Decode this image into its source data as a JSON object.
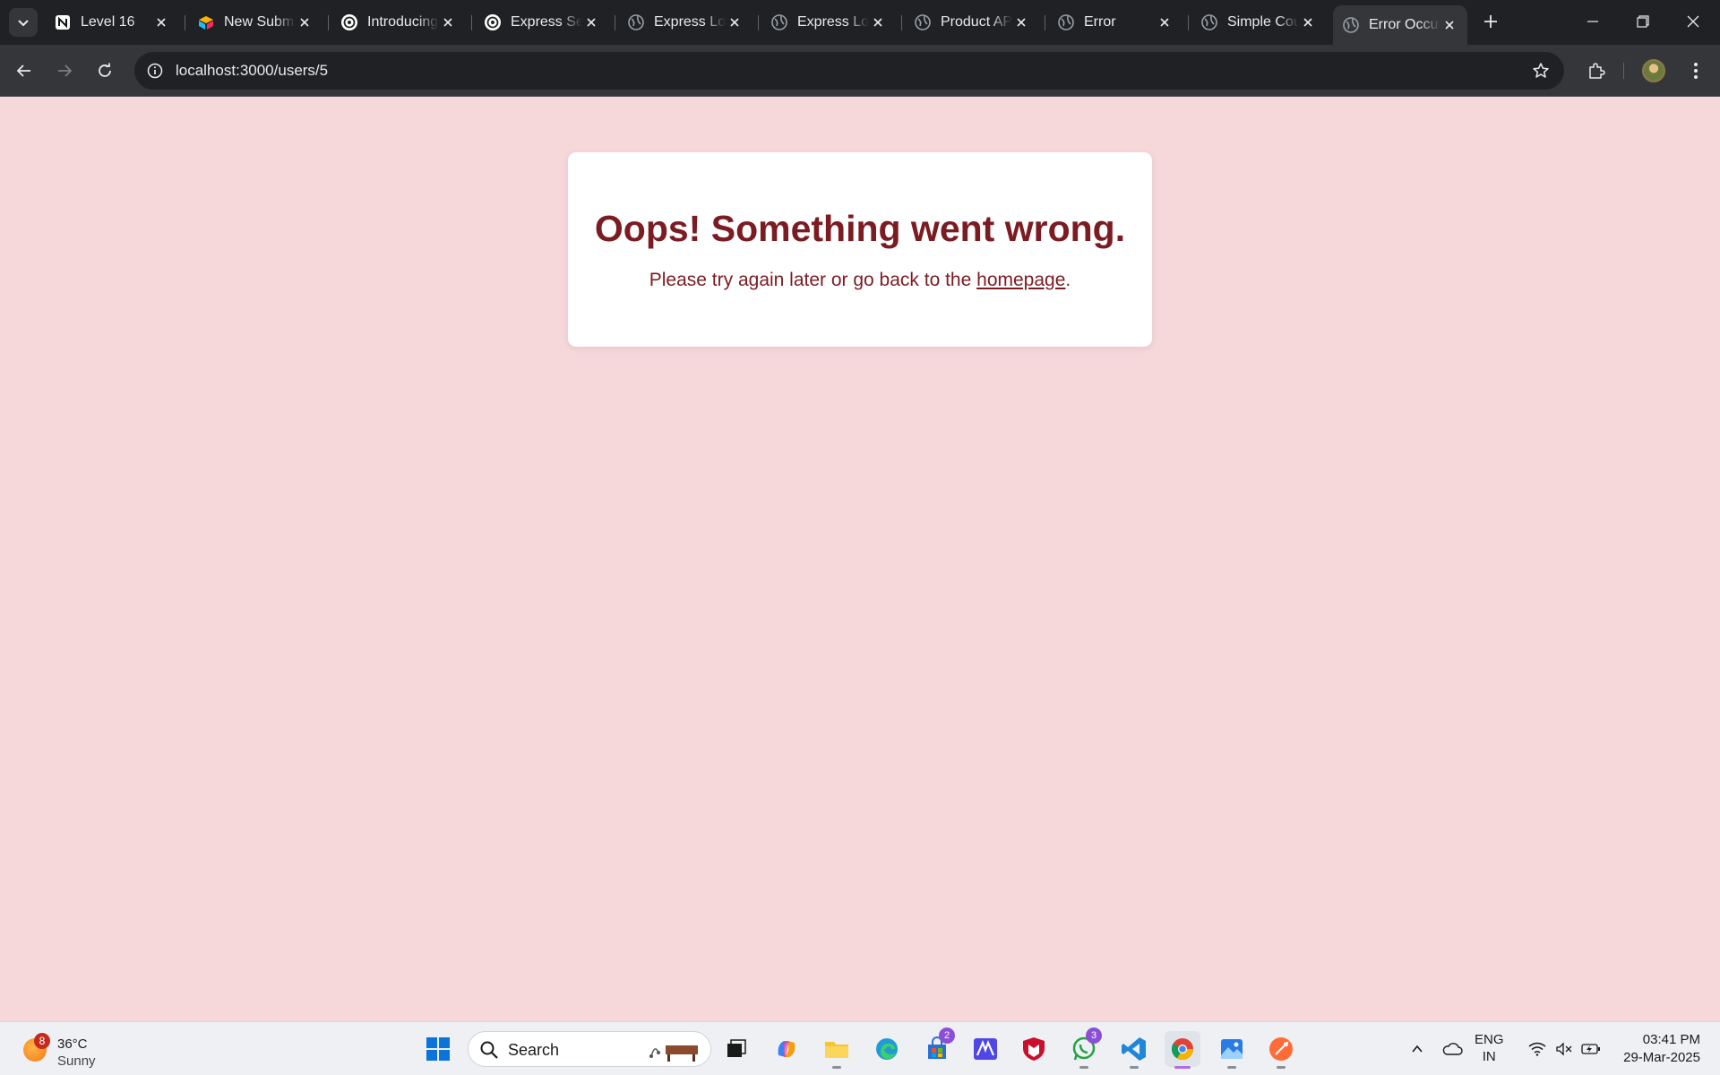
{
  "browser": {
    "tabs": [
      {
        "label": "Level 16",
        "icon": "notion-icon"
      },
      {
        "label": "New Submission",
        "icon": "cube-icon"
      },
      {
        "label": "Introducing",
        "icon": "openai-icon"
      },
      {
        "label": "Express Server",
        "icon": "openai-icon"
      },
      {
        "label": "Express Logging",
        "icon": "globe-icon"
      },
      {
        "label": "Express Logging",
        "icon": "globe-icon"
      },
      {
        "label": "Product API",
        "icon": "globe-icon"
      },
      {
        "label": "Error",
        "icon": "globe-icon"
      },
      {
        "label": "Simple Counter",
        "icon": "globe-icon"
      },
      {
        "label": "Error Occurred",
        "icon": "globe-icon",
        "active": true
      }
    ],
    "url": "localhost:3000/users/5"
  },
  "page": {
    "title": "Oops! Something went wrong.",
    "message_before": "Please try again later or go back to the ",
    "link_text": "homepage",
    "message_after": ".",
    "colors": {
      "background": "#f6d7da",
      "text": "#7b1b22",
      "card": "#ffffff"
    }
  },
  "taskbar": {
    "weather": {
      "temp": "36°C",
      "condition": "Sunny",
      "badge": "8"
    },
    "search_label": "Search",
    "badges": {
      "store": "2",
      "whatsapp": "3"
    },
    "lang_line1": "ENG",
    "lang_line2": "IN",
    "time": "03:41 PM",
    "date": "29-Mar-2025"
  }
}
